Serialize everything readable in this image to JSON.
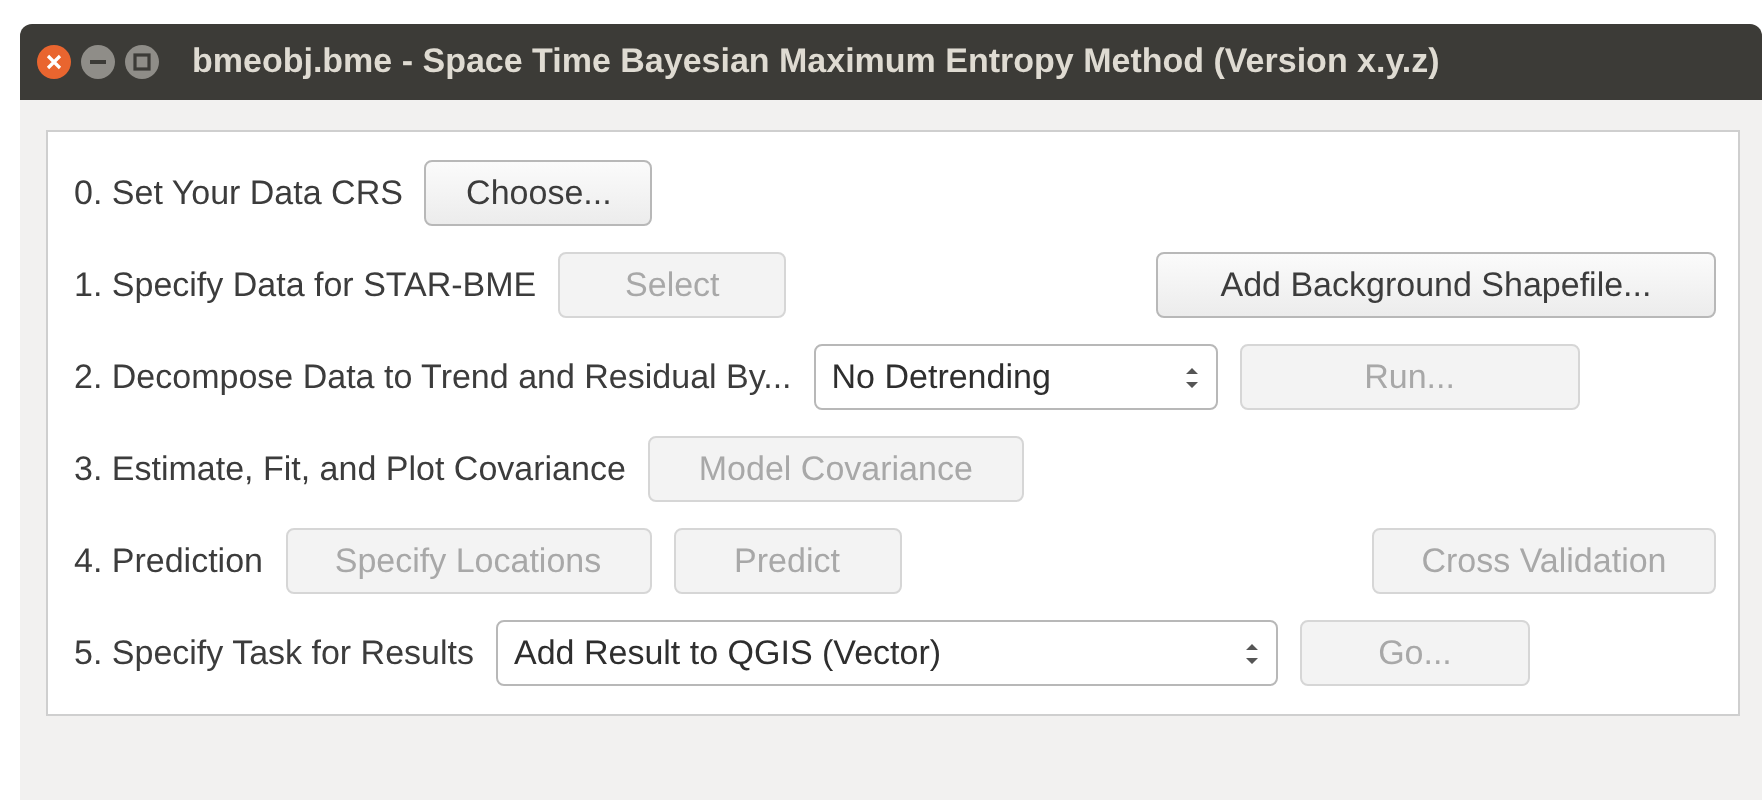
{
  "window": {
    "title": "bmeobj.bme - Space Time Bayesian Maximum Entropy Method (Version x.y.z)"
  },
  "rows": [
    {
      "label": "0. Set Your Data CRS",
      "controls": [
        {
          "kind": "button",
          "text": "Choose...",
          "disabled": false
        }
      ]
    },
    {
      "label": "1. Specify Data for STAR-BME",
      "controls": [
        {
          "kind": "button",
          "text": "Select",
          "disabled": true
        },
        {
          "kind": "button",
          "text": "Add Background Shapefile...",
          "disabled": false
        }
      ]
    },
    {
      "label": "2. Decompose Data to Trend and Residual By...",
      "controls": [
        {
          "kind": "combo",
          "text": "No Detrending",
          "disabled": false
        },
        {
          "kind": "button",
          "text": "Run...",
          "disabled": true
        }
      ]
    },
    {
      "label": "3. Estimate, Fit, and Plot Covariance",
      "controls": [
        {
          "kind": "button",
          "text": "Model Covariance",
          "disabled": true
        }
      ]
    },
    {
      "label": "4. Prediction",
      "controls": [
        {
          "kind": "button",
          "text": "Specify Locations",
          "disabled": true
        },
        {
          "kind": "button",
          "text": "Predict",
          "disabled": true
        },
        {
          "kind": "button",
          "text": "Cross Validation",
          "disabled": true
        }
      ]
    },
    {
      "label": "5. Specify Task for Results",
      "controls": [
        {
          "kind": "combo",
          "text": "Add Result to QGIS (Vector)",
          "disabled": false
        },
        {
          "kind": "button",
          "text": "Go...",
          "disabled": true
        }
      ]
    }
  ]
}
